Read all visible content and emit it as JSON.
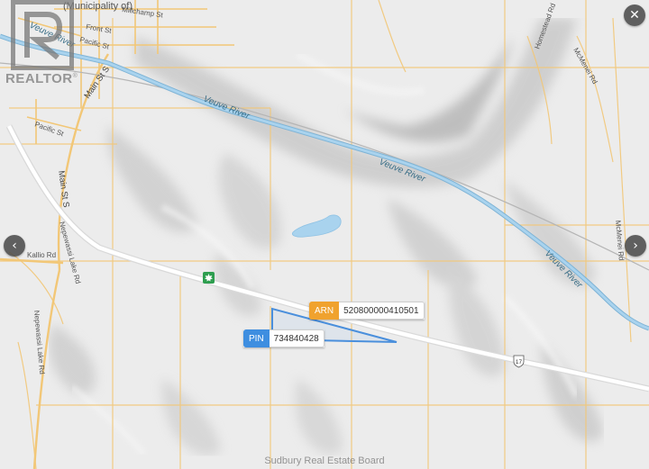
{
  "map": {
    "municipality_label": "(Municipality of)",
    "streets": {
      "millchamp": "Millchamp St",
      "front": "Front St",
      "pacific_north": "Pacific St",
      "pacific_south": "Pacific St",
      "main_north": "Main St S",
      "main_south": "Main St S",
      "nepewassi_upper": "Nepewassi Lake Rd",
      "kallio": "Kallio Rd",
      "nepewassi_lower": "Nepewassi Lake Rd",
      "homestead": "Homestead Rd",
      "mcmenei_north": "McMenei Rd",
      "mcmenei_south": "McMenei Rd",
      "hwy_shield": "17"
    },
    "rivers": {
      "upper": "Veuve River",
      "middle": "Veuve River",
      "lower": "Veuve River",
      "east": "Veuve River"
    },
    "colors": {
      "background": "#ececec",
      "road": "#f2c777",
      "highway": "#ffffff",
      "water": "#a9d3ee",
      "river_edge": "#7fb4d6",
      "parcel_outline": "#4a8fdc",
      "arn_badge": "#f0a22e",
      "pin_badge": "#3e8ee0",
      "park_marker": "#2e9e4f"
    },
    "icons": {
      "park": "maple-leaf-icon"
    }
  },
  "logo": {
    "text": "REALTOR",
    "registered": "®"
  },
  "controls": {
    "close": "✕",
    "prev": "‹",
    "next": "›"
  },
  "parcel": {
    "arn_label": "ARN",
    "arn_value": "520800000410501",
    "pin_label": "PIN",
    "pin_value": "734840428"
  },
  "footer": {
    "credit": "Sudbury Real Estate Board"
  }
}
